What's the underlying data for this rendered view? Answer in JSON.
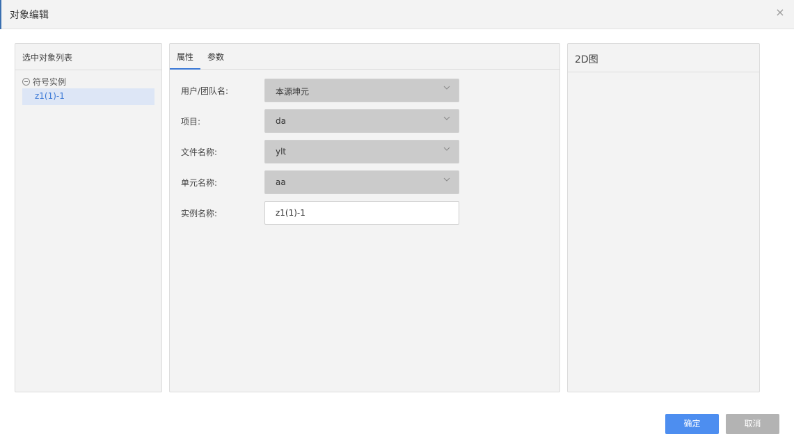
{
  "dialog": {
    "title": "对象编辑",
    "close_icon": "×"
  },
  "left_panel": {
    "header": "选中对象列表",
    "tree": {
      "group_label": "符号实例",
      "items": [
        "z1(1)-1"
      ]
    }
  },
  "mid_panel": {
    "tabs": [
      {
        "label": "属性",
        "active": true
      },
      {
        "label": "参数",
        "active": false
      }
    ],
    "form": [
      {
        "label": "用户/团队名:",
        "value": "本源坤元",
        "type": "select"
      },
      {
        "label": "项目:",
        "value": "da",
        "type": "select"
      },
      {
        "label": "文件名称:",
        "value": "ylt",
        "type": "select"
      },
      {
        "label": "单元名称:",
        "value": "aa",
        "type": "select"
      },
      {
        "label": "实例名称:",
        "value": "z1(1)-1",
        "type": "input"
      }
    ]
  },
  "right_panel": {
    "header": "2D图"
  },
  "buttons": {
    "ok": "确定",
    "cancel": "取消"
  },
  "colors": {
    "accent": "#4d8ef0",
    "selected_bg": "#dde6f6",
    "select_bg": "#cbcbcb"
  }
}
